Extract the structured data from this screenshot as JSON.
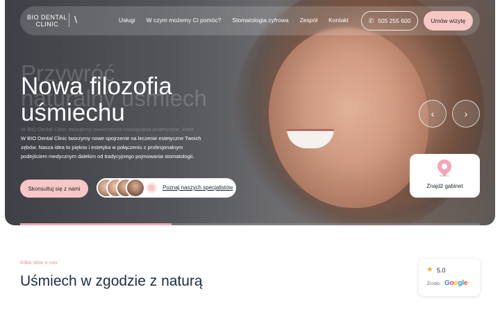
{
  "brand": {
    "line1": "BIO DENTAL",
    "line2": "CLINIC",
    "mark": "\\"
  },
  "nav": {
    "items": [
      {
        "label": "Usługi"
      },
      {
        "label": "W czym możemy Ci pomóc?"
      },
      {
        "label": "Stomatologia cyfrowa"
      },
      {
        "label": "Zespół"
      },
      {
        "label": "Kontakt"
      }
    ],
    "phone": "505 255 600",
    "book_label": "Umów wizytę"
  },
  "hero": {
    "ghost_heading": "Przywróć\nnaturalny uśmiech",
    "headline": "Nowa filozofia\nuśmiechu",
    "ghost_description": "W BIO Dental Clinic stosujemy nowoczesne rozwiązania protetyczne, które",
    "description": "W BIO Dental Clinic tworzymy nowe spojrzenie na leczenie estetyczne Twoich zębów. Nasza idea to piękno i estetyka w połączeniu z profesjonalnym podejściem medycznym dalekim od tradycyjnego pojmowania stomatologii.",
    "consult_label": "Skonsultuj się z nami",
    "specialists_label": "Poznaj naszych specjalistów",
    "prev_arrow": "‹",
    "next_arrow": "›",
    "find_label": "Znajdź gabinet",
    "slide_progress": 0.33
  },
  "section": {
    "kicker": "Kilka słów o nas",
    "title": "Uśmiech w zgodzie z naturą"
  },
  "rating": {
    "value": "5.0",
    "source_label": "Źródło:",
    "google": [
      "G",
      "o",
      "o",
      "g",
      "l",
      "e"
    ]
  },
  "colors": {
    "accent_pink": "#f7c7c5",
    "navy": "#1d2d44",
    "star": "#f2b21a"
  }
}
